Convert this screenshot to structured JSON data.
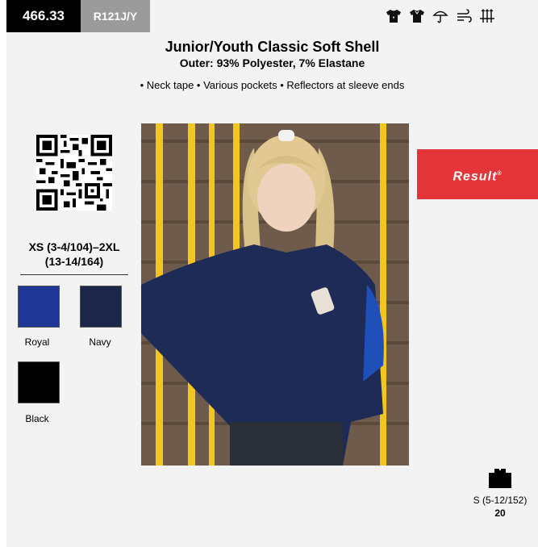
{
  "header": {
    "article_number": "466.33",
    "style_code": "R121J/Y",
    "care_icons": [
      "tshirt-icon",
      "tshirt-outline-icon",
      "water-repellent-icon",
      "windproof-icon",
      "breathable-icon"
    ]
  },
  "product": {
    "title": "Junior/Youth Classic Soft Shell",
    "material": "Outer: 93% Polyester, 7% Elastane",
    "features": "• Neck tape • Various pockets • Reflectors at sleeve ends"
  },
  "sizes": {
    "line1": "XS (3-4/104)–2XL",
    "line2": "(13-14/164)"
  },
  "colors": [
    {
      "name": "Royal",
      "hex": "#1e3796"
    },
    {
      "name": "Navy",
      "hex": "#1c2649"
    },
    {
      "name": "Black",
      "hex": "#000000"
    }
  ],
  "brand": {
    "logo_text": "Result",
    "logo_color": "#e3353a"
  },
  "packaging": {
    "size": "S (5-12/152)",
    "quantity": "20"
  }
}
